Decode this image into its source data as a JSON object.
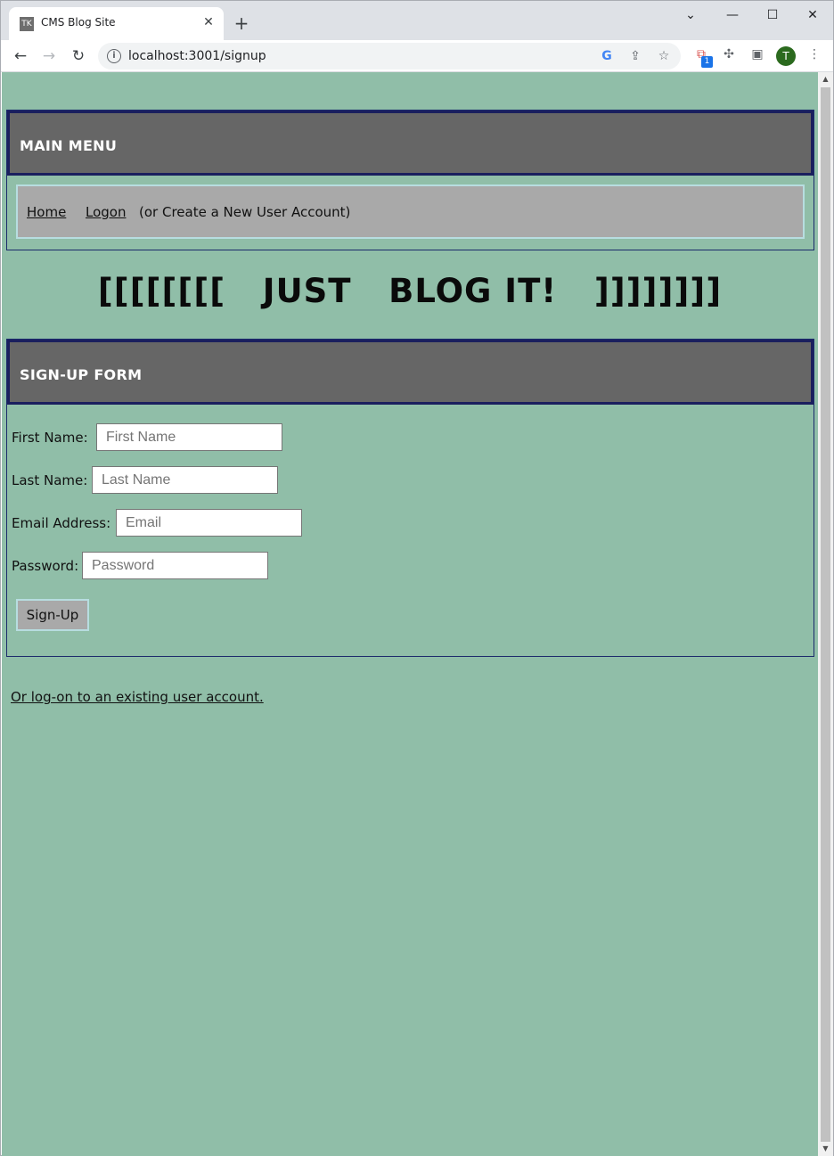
{
  "browser": {
    "tab_title": "CMS Blog Site",
    "tab_favicon_text": "TK",
    "url": "localhost:3001/signup",
    "profile_initial": "T",
    "extension_badge": "1",
    "icons": {
      "back": "arrow-left-icon",
      "forward": "arrow-right-icon",
      "reload": "reload-icon",
      "info": "info-icon",
      "google": "google-icon",
      "share": "share-icon",
      "bookmark": "star-icon",
      "extensions": "puzzle-icon",
      "side_panel": "side-panel-icon",
      "menu": "kebab-menu-icon"
    }
  },
  "main_menu": {
    "title": "MAIN MENU",
    "links": {
      "home": "Home",
      "logon": "Logon"
    },
    "note": "(or Create a New User Account)"
  },
  "slogan": "[[[[[[[[   JUST   BLOG IT!   ]]]]]]]]",
  "signup_form": {
    "title": "SIGN-UP FORM",
    "first_name": {
      "label": "First Name:",
      "placeholder": "First Name",
      "value": ""
    },
    "last_name": {
      "label": "Last Name:",
      "placeholder": "Last Name",
      "value": ""
    },
    "email": {
      "label": "Email Address:",
      "placeholder": "Email",
      "value": ""
    },
    "password": {
      "label": "Password:",
      "placeholder": "Password",
      "value": ""
    },
    "submit_label": "Sign-Up"
  },
  "alt_link": "Or log-on to an existing user account.",
  "colors": {
    "page_background": "#90bea8",
    "panel_header": "#666666",
    "panel_border": "#1a1f5e",
    "menu_box": "#a9a9a9",
    "menu_box_border": "#b7dde0"
  }
}
